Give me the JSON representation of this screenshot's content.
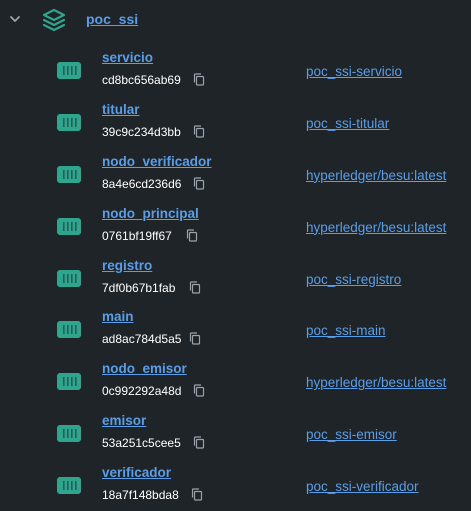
{
  "group": {
    "name": "poc_ssi",
    "icon": "stack-icon",
    "expanded": true
  },
  "containers": [
    {
      "name": "servicio",
      "id": "cd8bc656ab69",
      "image": "poc_ssi-servicio"
    },
    {
      "name": "titular",
      "id": "39c9c234d3bb",
      "image": "poc_ssi-titular"
    },
    {
      "name": "nodo_verificador",
      "id": "8a4e6cd236d6",
      "image": "hyperledger/besu:latest"
    },
    {
      "name": "nodo_principal",
      "id": "0761bf19ff67",
      "image": "hyperledger/besu:latest"
    },
    {
      "name": "registro",
      "id": "7df0b67b1fab",
      "image": "poc_ssi-registro"
    },
    {
      "name": "main",
      "id": "ad8ac784d5a5",
      "image": "poc_ssi-main"
    },
    {
      "name": "nodo_emisor",
      "id": "0c992292a48d",
      "image": "hyperledger/besu:latest"
    },
    {
      "name": "emisor",
      "id": "53a251c5cee5",
      "image": "poc_ssi-emisor"
    },
    {
      "name": "verificador",
      "id": "18a7f148bda8",
      "image": "poc_ssi-verificador"
    }
  ],
  "colors": {
    "background": "#1f2428",
    "link": "#5a9ee8",
    "container_icon": "#2fa58e",
    "text": "#ffffff",
    "muted": "#9aa3ab"
  }
}
